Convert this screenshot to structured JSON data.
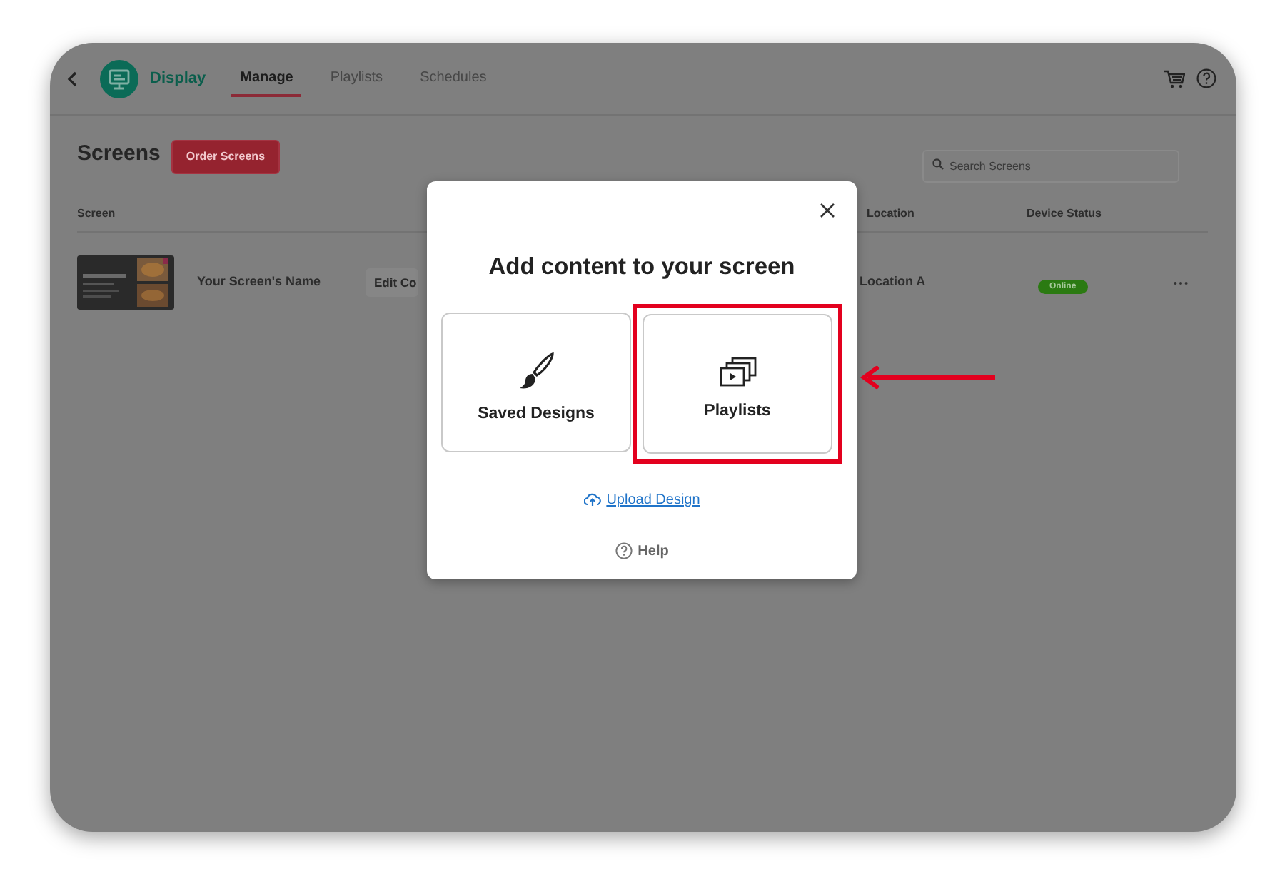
{
  "app_header": {
    "app_name": "Display",
    "tabs": [
      {
        "label": "Manage",
        "selected": true
      },
      {
        "label": "Playlists",
        "selected": false
      },
      {
        "label": "Schedules",
        "selected": false
      }
    ]
  },
  "page": {
    "title": "Screens",
    "order_button": "Order Screens",
    "search": {
      "placeholder": "Search Screens"
    }
  },
  "table": {
    "columns": [
      "Screen",
      "Location",
      "Device Status"
    ],
    "rows": [
      {
        "name": "Your Screen's Name",
        "action": "Edit Co",
        "location": "Location A",
        "status": "Online"
      }
    ]
  },
  "modal": {
    "title": "Add content to your screen",
    "options": [
      {
        "kind": "brush",
        "label": "Saved Designs",
        "highlighted": false
      },
      {
        "kind": "playlist",
        "label": "Playlists",
        "highlighted": true
      }
    ],
    "upload_link": "Upload Design",
    "help": "Help"
  }
}
